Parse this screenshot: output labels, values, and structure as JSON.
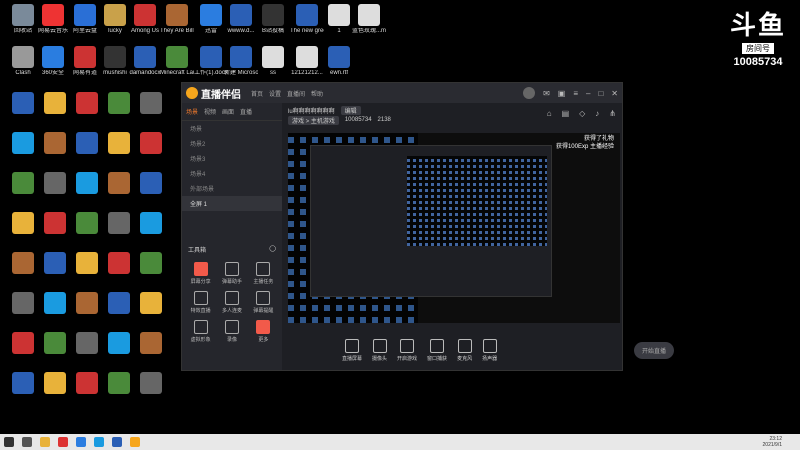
{
  "desktop_icons": [
    {
      "label": "回收站",
      "color": "#7a8a9a"
    },
    {
      "label": "网易云音乐",
      "color": "#e33"
    },
    {
      "label": "阿里云盘",
      "color": "#2a6fd6"
    },
    {
      "label": "lucky",
      "color": "#c9a14a"
    },
    {
      "label": "Among Us",
      "color": "#c33"
    },
    {
      "label": "They Are Billions",
      "color": "#a63"
    },
    {
      "label": "迅雷",
      "color": "#2b7de0"
    },
    {
      "label": "wwww.d...",
      "color": "#2b5fb5"
    },
    {
      "label": "B站投稿",
      "color": "#333"
    },
    {
      "label": "The new green...",
      "color": "#2b5fb5"
    },
    {
      "label": "1",
      "color": "#ddd"
    },
    {
      "label": "蓝色玫瑰...mp4",
      "color": "#ddd"
    },
    {
      "label": "Clash",
      "color": "#999"
    },
    {
      "label": "360安全",
      "color": "#2a7de0"
    },
    {
      "label": "网易有道",
      "color": "#c33"
    },
    {
      "label": "mushishi",
      "color": "#333"
    },
    {
      "label": "damandocx",
      "color": "#2b5fb5"
    },
    {
      "label": "Minecraft Launcher",
      "color": "#4a8a3a"
    },
    {
      "label": "工作(1).docx",
      "color": "#2b5fb5"
    },
    {
      "label": "新建 Microsoft...",
      "color": "#2b5fb5"
    },
    {
      "label": "ss",
      "color": "#ddd"
    },
    {
      "label": "12121212...",
      "color": "#ddd"
    },
    {
      "label": "ewn.rtf",
      "color": "#2b5fb5"
    }
  ],
  "watermark": {
    "logo": "斗鱼",
    "room_label": "房间号",
    "room_id": "10085734"
  },
  "app": {
    "brand": "直播伴侣",
    "tabs": [
      "首页",
      "设置",
      "直播间",
      "帮助"
    ],
    "left_tabs": [
      "场景",
      "视频",
      "画面",
      "直播"
    ],
    "scenes": [
      "场景",
      "场景2",
      "场景3",
      "场景4",
      "外部场景",
      "全屏 1"
    ],
    "tools_title": "工具箱",
    "tools": [
      {
        "label": "屏幕分享",
        "hot": true
      },
      {
        "label": "弹幕助手",
        "hot": false
      },
      {
        "label": "主播任务",
        "hot": false
      },
      {
        "label": "特效直播",
        "hot": false
      },
      {
        "label": "多人连麦",
        "hot": false
      },
      {
        "label": "弹幕提醒",
        "hot": false
      },
      {
        "label": "虚拟形象",
        "hot": false
      },
      {
        "label": "录像",
        "hot": false
      },
      {
        "label": "更多",
        "hot": true
      }
    ],
    "room_title": "lu啊啊啊啊啊啊啊",
    "edit_label": "编辑",
    "category": "游戏 > 主机游戏",
    "room_no": "10085734",
    "viewers": "2138",
    "overlay_line1": "获得了礼物",
    "overlay_line2": "获得100Exp 主播经验",
    "bottom_buttons": [
      "直播屏幕",
      "摄像头",
      "开启游戏",
      "窗口捕获",
      "麦克风",
      "扬声器"
    ],
    "start_live": "开始直播"
  },
  "clock": {
    "time": "23:12",
    "date": "2021/9/1"
  }
}
